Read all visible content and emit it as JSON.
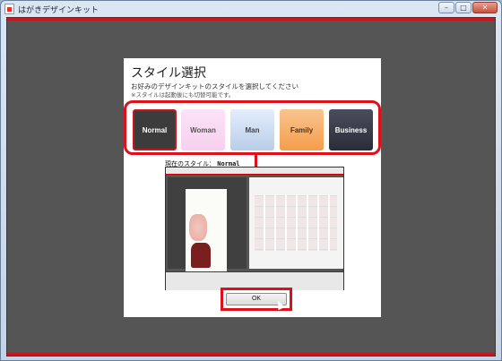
{
  "window": {
    "title": "はがきデザインキット",
    "buttons": [
      "–",
      "□",
      "✕"
    ]
  },
  "dialog": {
    "title": "スタイル選択",
    "description": "お好みのデザインキットのスタイルを選択してください",
    "note": "※スタイルは起動後にも切替可能です。",
    "styles": [
      {
        "label": "Normal",
        "selected": true,
        "color": "#3c3c3c"
      },
      {
        "label": "Woman",
        "selected": false,
        "color": "#f6d0ef"
      },
      {
        "label": "Man",
        "selected": false,
        "color": "#b9cde9"
      },
      {
        "label": "Family",
        "selected": false,
        "color": "#f59d4b"
      },
      {
        "label": "Business",
        "selected": false,
        "color": "#2b2c38"
      }
    ],
    "current_style_label": "現在のスタイル：",
    "current_style_value": "Normal",
    "ok_label": "OK"
  },
  "colors": {
    "accent": "#e0101a",
    "client_bg": "#555555"
  }
}
